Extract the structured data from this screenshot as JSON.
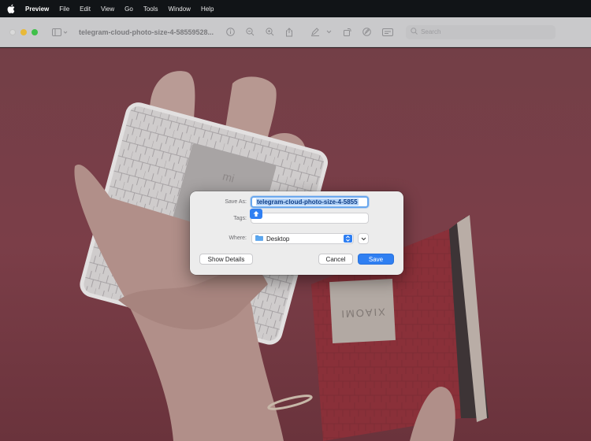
{
  "menubar": {
    "app_name": "Preview",
    "items": [
      "File",
      "Edit",
      "View",
      "Go",
      "Tools",
      "Window",
      "Help"
    ]
  },
  "toolbar": {
    "document_title": "telegram-cloud-photo-size-4-58559528...",
    "search_placeholder": "Search"
  },
  "photo": {
    "device_label": "XIAOMI",
    "device_logo": "mi"
  },
  "save_dialog": {
    "save_as_label": "Save As:",
    "save_as_value": "telegram-cloud-photo-size-4-5855",
    "tags_label": "Tags:",
    "tags_value": "",
    "where_label": "Where:",
    "where_value": "Desktop",
    "show_details_label": "Show Details",
    "cancel_label": "Cancel",
    "save_label": "Save"
  },
  "colors": {
    "accent": "#2f7ff2",
    "menubar_bg": "#111417"
  }
}
